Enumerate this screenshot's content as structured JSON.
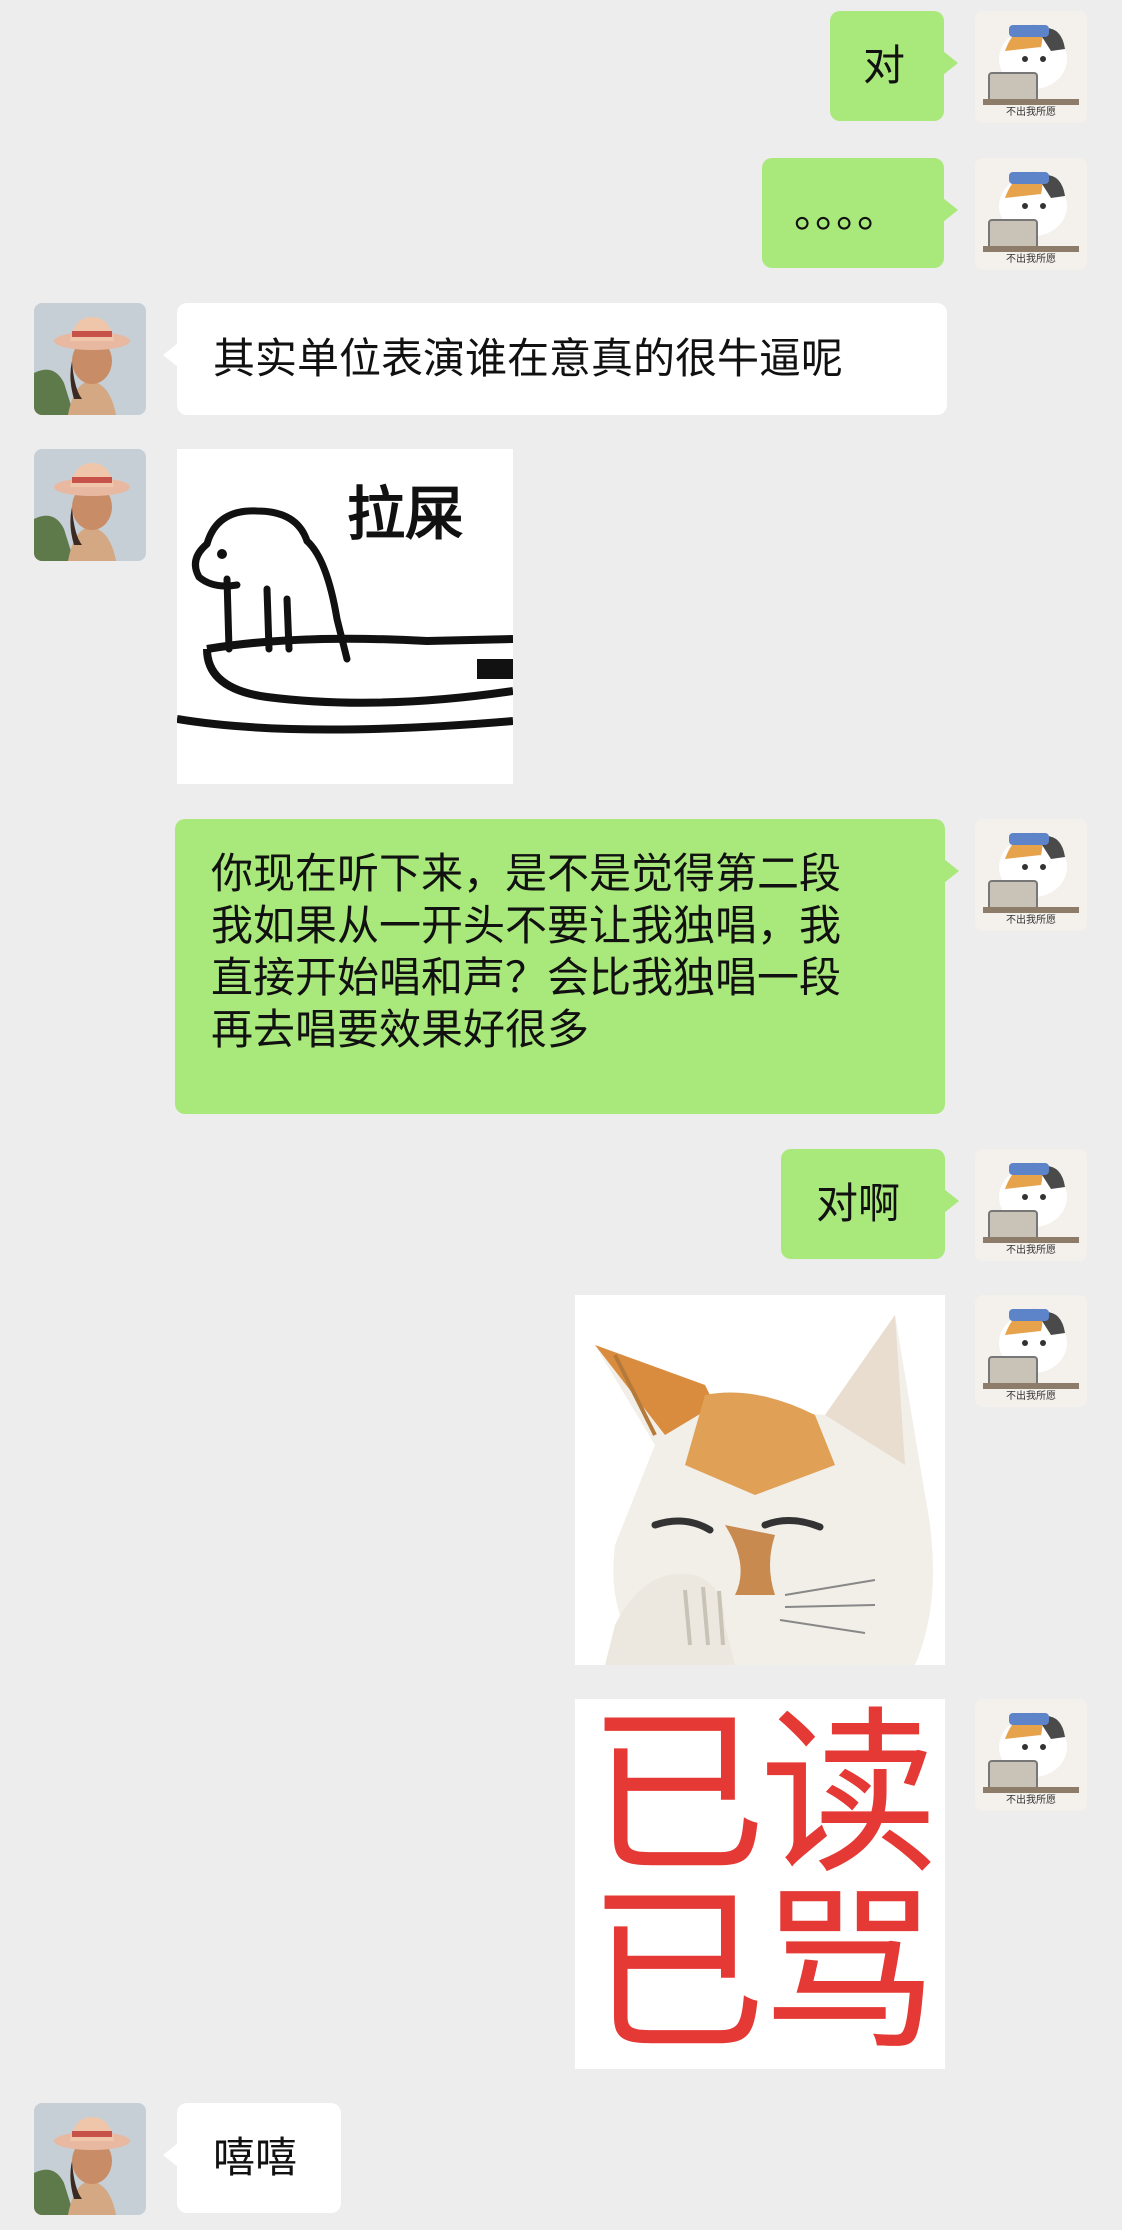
{
  "messages": [
    {
      "side": "me",
      "type": "text",
      "text": "对"
    },
    {
      "side": "me",
      "type": "text",
      "text": "。。。。"
    },
    {
      "side": "them",
      "type": "text",
      "text": "其实单位表演谁在意真的很牛逼呢"
    },
    {
      "side": "them",
      "type": "sticker",
      "name": "bear-toilet-sticker",
      "caption": "拉屎"
    },
    {
      "side": "me",
      "type": "text",
      "lines": [
        "你现在听下来，是不是觉得第二段",
        "我如果从一开头不要让我独唱，我",
        "直接开始唱和声？会比我独唱一段",
        "再去唱要效果好很多"
      ]
    },
    {
      "side": "me",
      "type": "text",
      "text": "对啊"
    },
    {
      "side": "me",
      "type": "sticker",
      "name": "cat-pinching-nose-sticker"
    },
    {
      "side": "me",
      "type": "sticker",
      "name": "read-cursed-sticker",
      "lines": [
        "已读",
        "已骂"
      ]
    },
    {
      "side": "them",
      "type": "text",
      "text": "嘻嘻"
    }
  ],
  "avatars": {
    "me": {
      "icon": "calico-cat-at-laptop-avatar",
      "caption": "不出我所愿"
    },
    "them": {
      "icon": "woman-in-sun-hat-avatar"
    }
  },
  "colors": {
    "background": "#ededed",
    "my_bubble": "#a9e87a",
    "their_bubble": "#ffffff",
    "read_text": "#e53935"
  }
}
